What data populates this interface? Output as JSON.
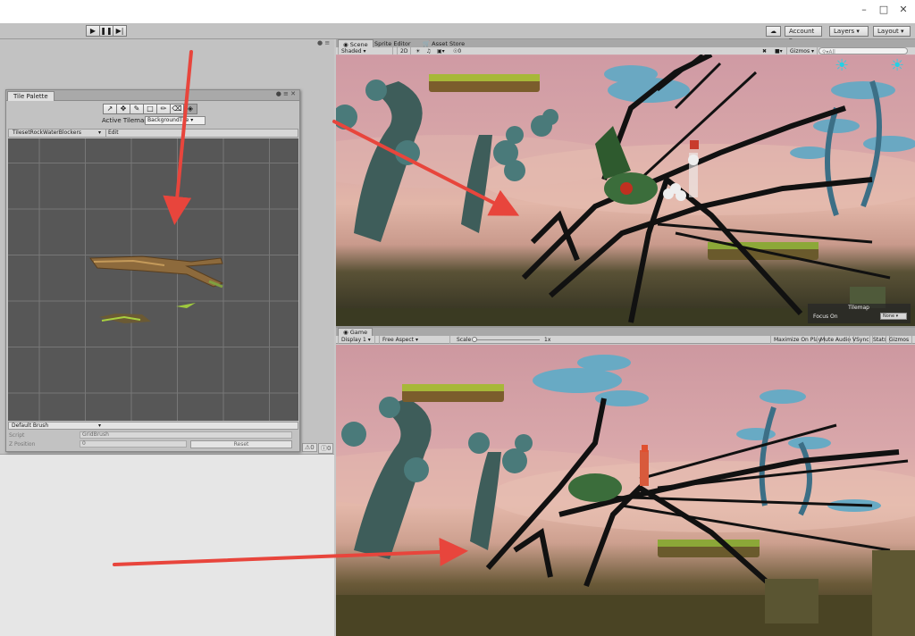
{
  "toolbar": {
    "play_icon": "play-icon",
    "pause_icon": "pause-icon",
    "step_icon": "step-icon",
    "cloud_icon": "cloud-icon",
    "account_label": "Account",
    "layers_label": "Layers",
    "layout_label": "Layout"
  },
  "tile_palette": {
    "title": "Tile Palette",
    "active_tilemap_label": "Active Tilemap",
    "active_tilemap_value": "BackgroundTile",
    "palette_name": "TilesetRockWaterBlockers",
    "edit_label": "Edit",
    "brush_label": "Default Brush",
    "script_label": "Script",
    "script_value": "GridBrush",
    "z_position_label": "Z Position",
    "z_position_value": "0",
    "reset_label": "Reset",
    "tools": [
      "select-tool-icon",
      "move-tool-icon",
      "paint-brush-icon",
      "box-fill-icon",
      "eyedropper-icon",
      "eraser-icon",
      "flood-fill-icon"
    ]
  },
  "left_panel": {
    "count_a": "0",
    "count_b": "0"
  },
  "scene": {
    "tabs": [
      "Scene",
      "Sprite Editor",
      "Asset Store"
    ],
    "shading": "Shaded",
    "mode_2d": "2D",
    "fx_count": "0",
    "gizmos_label": "Gizmos",
    "search_placeholder": "All",
    "tilemap_title": "Tilemap",
    "focus_on_label": "Focus On",
    "focus_on_value": "None"
  },
  "game": {
    "tab": "Game",
    "display": "Display 1",
    "aspect": "Free Aspect",
    "scale_label": "Scale",
    "scale_value": "1x",
    "maximize_label": "Maximize On Play",
    "mute_label": "Mute Audio",
    "vsync_label": "VSync",
    "stats_label": "Stats",
    "gizmos_label": "Gizmos"
  },
  "colors": {
    "arrow": "#e8453c",
    "sky_pink": "#d6a3a8",
    "palette_grid": "#575757",
    "mushroom_blue": "#5fb0c8"
  }
}
